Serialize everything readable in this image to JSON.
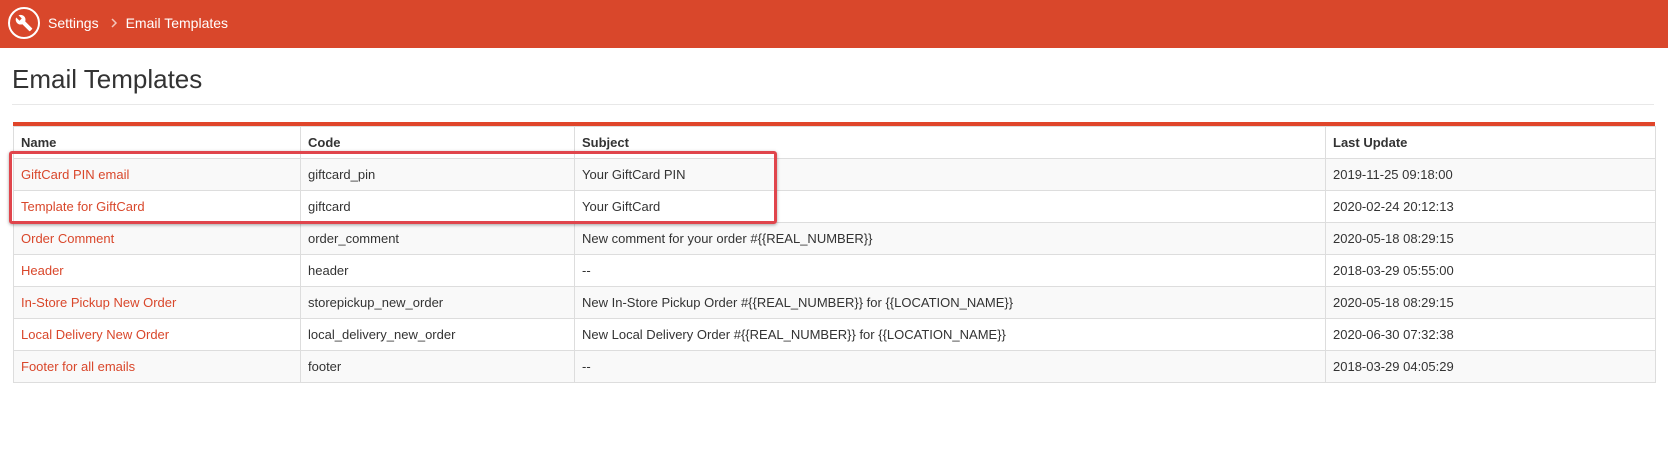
{
  "header": {
    "breadcrumb": [
      "Settings",
      "Email Templates"
    ],
    "bar_color": "#d9472b",
    "logo_icon": "wrench-icon",
    "separator_icon": "chevron-right-icon"
  },
  "page": {
    "title": "Email Templates"
  },
  "table": {
    "columns": [
      "Name",
      "Code",
      "Subject",
      "Last Update"
    ],
    "rows": [
      {
        "name": "GiftCard PIN email",
        "code": "giftcard_pin",
        "subject": "Your GiftCard PIN",
        "updated": "2019-11-25 09:18:00"
      },
      {
        "name": "Template for GiftCard",
        "code": "giftcard",
        "subject": "Your GiftCard",
        "updated": "2020-02-24 20:12:13"
      },
      {
        "name": "Order Comment",
        "code": "order_comment",
        "subject": "New comment for your order #{{REAL_NUMBER}}",
        "updated": "2020-05-18 08:29:15"
      },
      {
        "name": "Header",
        "code": "header",
        "subject": "--",
        "updated": "2018-03-29 05:55:00"
      },
      {
        "name": "In-Store Pickup New Order",
        "code": "storepickup_new_order",
        "subject": "New In-Store Pickup Order #{{REAL_NUMBER}} for {{LOCATION_NAME}}",
        "updated": "2020-05-18 08:29:15"
      },
      {
        "name": "Local Delivery New Order",
        "code": "local_delivery_new_order",
        "subject": "New Local Delivery Order #{{REAL_NUMBER}} for {{LOCATION_NAME}}",
        "updated": "2020-06-30 07:32:38"
      },
      {
        "name": "Footer for all emails",
        "code": "footer",
        "subject": "--",
        "updated": "2018-03-29 04:05:29"
      }
    ],
    "link_color": "#d9472b",
    "accent_color": "#e0452a"
  },
  "annotation": {
    "highlight_color": "#e0454c"
  }
}
